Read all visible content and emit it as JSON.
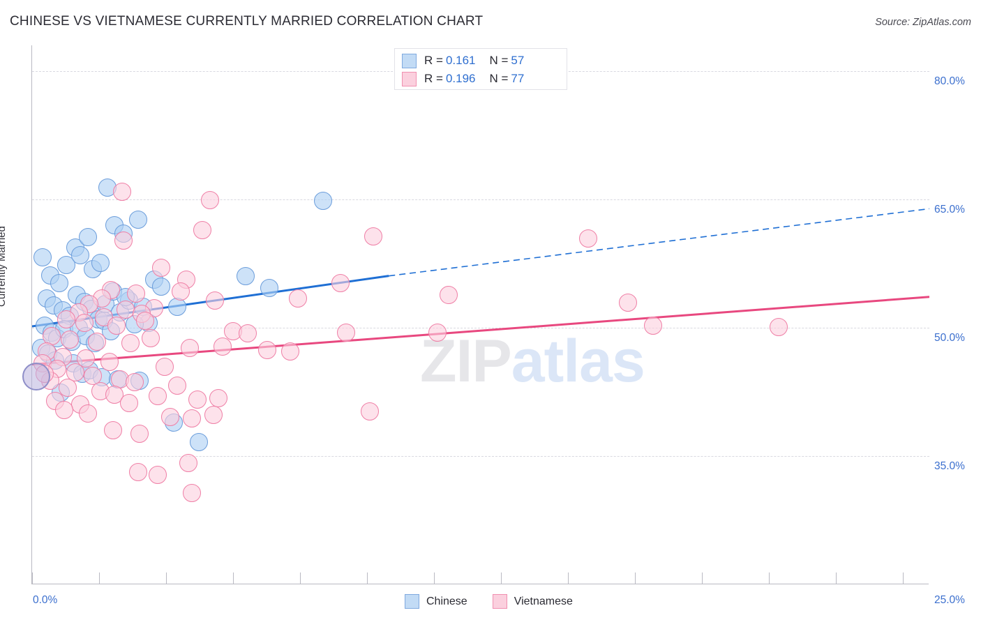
{
  "header": {
    "title": "CHINESE VS VIETNAMESE CURRENTLY MARRIED CORRELATION CHART",
    "source": "Source: ZipAtlas.com"
  },
  "watermark": {
    "part1": "ZIP",
    "part2": "atlas"
  },
  "stats": {
    "rows": [
      {
        "series": "Chinese",
        "r_label": "R =",
        "r_value": "0.161",
        "n_label": "N =",
        "n_value": "57",
        "color": "#c2dbf5"
      },
      {
        "series": "Vietnamese",
        "r_label": "R =",
        "r_value": "0.196",
        "n_label": "N =",
        "n_value": "77",
        "color": "#fbd0de"
      }
    ]
  },
  "legend": {
    "items": [
      {
        "label": "Chinese",
        "color": "#c2dbf5",
        "border": "#7fa9df"
      },
      {
        "label": "Vietnamese",
        "color": "#fbd0de",
        "border": "#f08fb0"
      }
    ]
  },
  "chart_data": {
    "type": "scatter",
    "title": "CHINESE VS VIETNAMESE CURRENTLY MARRIED CORRELATION CHART",
    "xlabel": "",
    "ylabel": "Currently Married",
    "xlim": [
      0.0,
      25.0
    ],
    "ylim": [
      20.0,
      83.0
    ],
    "grid": true,
    "legend_position": "bottom-center",
    "y_ticks": [
      "80.0%",
      "65.0%",
      "50.0%",
      "35.0%"
    ],
    "y_tick_values": [
      80.0,
      65.0,
      50.0,
      35.0
    ],
    "x_ticks": [
      "0.0%",
      "25.0%"
    ],
    "x_tick_values": [
      0.0,
      25.0
    ],
    "series": [
      {
        "name": "Chinese",
        "color": "#c2dbf5",
        "border": "#6b9ddb",
        "R": 0.161,
        "N": 57,
        "trendline": {
          "solid_from": [
            0.0,
            50.15
          ],
          "solid_to": [
            9.94,
            56.05
          ],
          "dashed_to": [
            25.0,
            63.9
          ],
          "color": "#1f6fd4"
        },
        "points": [
          [
            0.3,
            58.2
          ],
          [
            0.5,
            56.1
          ],
          [
            0.75,
            55.2
          ],
          [
            0.95,
            57.3
          ],
          [
            1.2,
            59.4
          ],
          [
            1.35,
            58.5
          ],
          [
            1.55,
            60.6
          ],
          [
            1.7,
            56.8
          ],
          [
            1.9,
            57.6
          ],
          [
            2.1,
            66.4
          ],
          [
            2.3,
            62.0
          ],
          [
            2.55,
            61.0
          ],
          [
            2.95,
            62.6
          ],
          [
            3.4,
            55.6
          ],
          [
            3.6,
            54.8
          ],
          [
            0.4,
            53.4
          ],
          [
            0.6,
            52.6
          ],
          [
            0.85,
            52.0
          ],
          [
            1.05,
            51.4
          ],
          [
            1.25,
            53.8
          ],
          [
            1.45,
            53.0
          ],
          [
            1.65,
            52.2
          ],
          [
            1.85,
            51.0
          ],
          [
            2.05,
            52.8
          ],
          [
            2.25,
            54.2
          ],
          [
            2.45,
            51.8
          ],
          [
            2.7,
            53.2
          ],
          [
            3.1,
            52.4
          ],
          [
            3.25,
            50.6
          ],
          [
            0.35,
            50.2
          ],
          [
            0.55,
            49.4
          ],
          [
            0.7,
            48.8
          ],
          [
            0.9,
            49.8
          ],
          [
            1.1,
            48.4
          ],
          [
            1.3,
            50.0
          ],
          [
            1.5,
            49.0
          ],
          [
            1.75,
            48.2
          ],
          [
            2.0,
            50.8
          ],
          [
            2.2,
            49.6
          ],
          [
            2.6,
            53.6
          ],
          [
            2.85,
            50.4
          ],
          [
            0.25,
            47.6
          ],
          [
            0.45,
            47.0
          ],
          [
            0.65,
            46.2
          ],
          [
            1.15,
            45.8
          ],
          [
            1.4,
            44.6
          ],
          [
            1.6,
            45.0
          ],
          [
            1.95,
            44.2
          ],
          [
            2.4,
            44.0
          ],
          [
            3.0,
            43.8
          ],
          [
            0.8,
            42.4
          ],
          [
            4.05,
            52.4
          ],
          [
            5.95,
            56.0
          ],
          [
            6.6,
            54.6
          ],
          [
            8.1,
            64.8
          ],
          [
            3.95,
            38.9
          ],
          [
            4.65,
            36.6
          ]
        ]
      },
      {
        "name": "Vietnamese",
        "color": "#fbd0de",
        "border": "#ef7fa6",
        "R": 0.196,
        "N": 77,
        "trendline": {
          "solid_from": [
            0.0,
            45.7
          ],
          "solid_to": [
            25.0,
            53.6
          ],
          "color": "#e8487f"
        },
        "points": [
          [
            2.5,
            65.9
          ],
          [
            4.95,
            64.9
          ],
          [
            2.55,
            60.2
          ],
          [
            4.75,
            61.4
          ],
          [
            9.5,
            60.7
          ],
          [
            15.5,
            60.4
          ],
          [
            3.6,
            57.0
          ],
          [
            4.3,
            55.6
          ],
          [
            8.6,
            55.2
          ],
          [
            2.2,
            54.4
          ],
          [
            2.9,
            54.0
          ],
          [
            4.15,
            54.2
          ],
          [
            1.95,
            53.4
          ],
          [
            5.1,
            53.2
          ],
          [
            7.4,
            53.4
          ],
          [
            11.6,
            53.8
          ],
          [
            16.6,
            52.9
          ],
          [
            1.6,
            52.8
          ],
          [
            2.6,
            52.1
          ],
          [
            3.4,
            52.3
          ],
          [
            1.3,
            51.8
          ],
          [
            2.0,
            51.2
          ],
          [
            3.05,
            51.6
          ],
          [
            0.95,
            51.0
          ],
          [
            1.45,
            50.6
          ],
          [
            2.35,
            50.2
          ],
          [
            3.15,
            50.8
          ],
          [
            5.6,
            49.6
          ],
          [
            6.0,
            49.3
          ],
          [
            8.75,
            49.4
          ],
          [
            11.3,
            49.4
          ],
          [
            17.3,
            50.2
          ],
          [
            20.8,
            50.1
          ],
          [
            0.55,
            49.0
          ],
          [
            1.05,
            48.6
          ],
          [
            1.8,
            48.4
          ],
          [
            2.75,
            48.2
          ],
          [
            3.3,
            48.8
          ],
          [
            4.4,
            47.6
          ],
          [
            5.3,
            47.8
          ],
          [
            6.55,
            47.4
          ],
          [
            7.2,
            47.2
          ],
          [
            0.4,
            47.2
          ],
          [
            0.85,
            46.6
          ],
          [
            1.5,
            46.4
          ],
          [
            2.15,
            46.0
          ],
          [
            3.7,
            45.4
          ],
          [
            0.3,
            45.8
          ],
          [
            0.7,
            45.2
          ],
          [
            1.2,
            44.8
          ],
          [
            1.7,
            44.4
          ],
          [
            2.45,
            44.0
          ],
          [
            2.85,
            43.6
          ],
          [
            4.05,
            43.2
          ],
          [
            0.5,
            43.8
          ],
          [
            1.0,
            43.0
          ],
          [
            1.9,
            42.6
          ],
          [
            2.3,
            42.2
          ],
          [
            3.5,
            42.0
          ],
          [
            4.6,
            41.6
          ],
          [
            5.2,
            41.8
          ],
          [
            0.65,
            41.4
          ],
          [
            1.35,
            41.0
          ],
          [
            2.7,
            41.2
          ],
          [
            0.9,
            40.4
          ],
          [
            1.55,
            40.0
          ],
          [
            3.85,
            39.6
          ],
          [
            4.45,
            39.4
          ],
          [
            5.05,
            39.8
          ],
          [
            9.4,
            40.2
          ],
          [
            2.25,
            38.0
          ],
          [
            3.0,
            37.6
          ],
          [
            4.35,
            34.2
          ],
          [
            2.95,
            33.1
          ],
          [
            3.5,
            32.8
          ],
          [
            4.45,
            30.7
          ],
          [
            0.35,
            44.6
          ]
        ]
      }
    ]
  }
}
